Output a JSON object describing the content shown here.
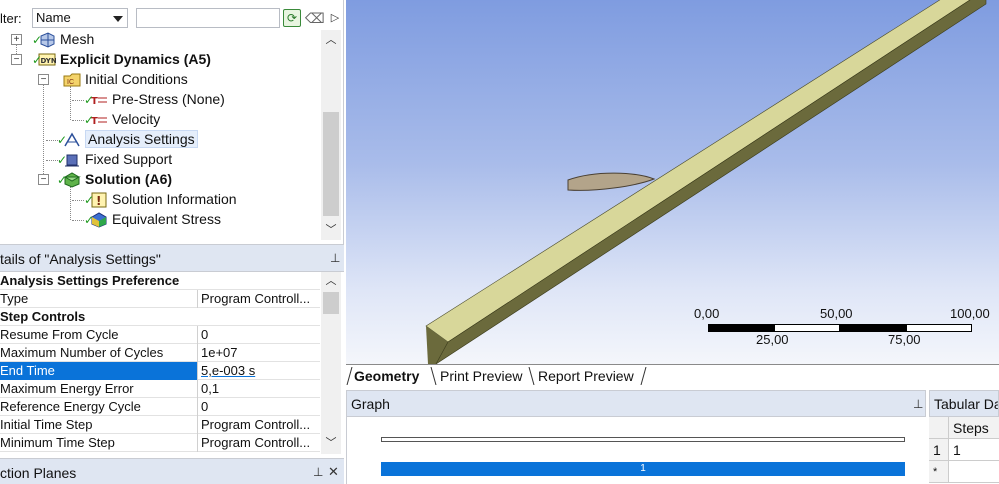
{
  "filter": {
    "label": "lter:",
    "select_value": "Name",
    "input_value": ""
  },
  "tree": {
    "items": [
      {
        "label": "Mesh"
      },
      {
        "label": "Explicit Dynamics (A5)"
      },
      {
        "label": "Initial Conditions"
      },
      {
        "label": "Pre-Stress (None)"
      },
      {
        "label": "Velocity"
      },
      {
        "label": "Analysis Settings"
      },
      {
        "label": "Fixed Support"
      },
      {
        "label": "Solution (A6)"
      },
      {
        "label": "Solution Information"
      },
      {
        "label": "Equivalent Stress"
      }
    ]
  },
  "details": {
    "title": "tails of \"Analysis Settings\"",
    "rows": [
      {
        "key": "Analysis Settings Preference",
        "value": ""
      },
      {
        "key": "Type",
        "value": "Program Controll..."
      },
      {
        "key": "Step Controls",
        "value": ""
      },
      {
        "key": "Resume From Cycle",
        "value": "0"
      },
      {
        "key": "Maximum Number of Cycles",
        "value": "1e+07"
      },
      {
        "key": "End Time",
        "value": "5,e-003 s"
      },
      {
        "key": "Maximum Energy Error",
        "value": "0,1"
      },
      {
        "key": "Reference Energy Cycle",
        "value": "0"
      },
      {
        "key": "Initial Time Step",
        "value": "Program Controll..."
      },
      {
        "key": "Minimum Time Step",
        "value": "Program Controll..."
      }
    ]
  },
  "section_planes": {
    "title": "ction Planes"
  },
  "viewport": {
    "scale": {
      "labels_top": [
        "0,00",
        "50,00",
        "100,00"
      ],
      "labels_bottom": [
        "25,00",
        "75,00"
      ]
    }
  },
  "tabs": [
    {
      "label": "Geometry"
    },
    {
      "label": "Print Preview"
    },
    {
      "label": "Report Preview"
    }
  ],
  "graph": {
    "title": "Graph",
    "bar_label": "1"
  },
  "tabular": {
    "title": "Tabular Da",
    "header": "Steps",
    "rows": [
      {
        "index": "1",
        "steps": "1"
      },
      {
        "index": "*",
        "steps": ""
      }
    ]
  },
  "colors": {
    "accent": "#0a73d9",
    "beam_top": "#d8d79a",
    "beam_side": "#6b6a3c",
    "check": "#1f9a1f"
  }
}
